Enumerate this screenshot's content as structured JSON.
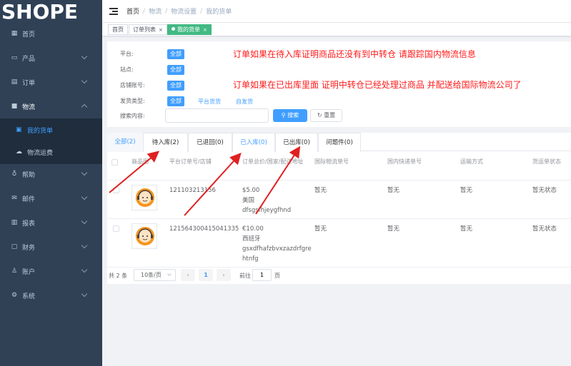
{
  "app": {
    "logo": "SHOPE"
  },
  "sidebar": {
    "items": [
      {
        "label": "首页",
        "icon": "dashboard-icon"
      },
      {
        "label": "产品",
        "icon": "product-icon"
      },
      {
        "label": "订单",
        "icon": "order-icon"
      },
      {
        "label": "物流",
        "icon": "truck-icon"
      },
      {
        "label": "帮助",
        "icon": "help-icon"
      },
      {
        "label": "邮件",
        "icon": "mail-icon"
      },
      {
        "label": "报表",
        "icon": "report-icon"
      },
      {
        "label": "财务",
        "icon": "finance-icon"
      },
      {
        "label": "账户",
        "icon": "user-icon"
      },
      {
        "label": "系统",
        "icon": "settings-icon"
      }
    ],
    "sub": [
      {
        "label": "我的货单",
        "icon": "list-icon"
      },
      {
        "label": "物流运费",
        "icon": "shipping-icon"
      }
    ]
  },
  "breadcrumb": [
    "首页",
    "物流",
    "物流设置",
    "我的货单"
  ],
  "tags": [
    {
      "label": "首页"
    },
    {
      "label": "订单列表",
      "close": "×"
    },
    {
      "label": "我的货单",
      "close": "×"
    }
  ],
  "filter": {
    "platform_label": "平台:",
    "site_label": "站点:",
    "account_label": "店铺账号:",
    "ship_type_label": "发货类型:",
    "search_label": "搜索内容:",
    "all": "全部",
    "platform_ship": "平台货货",
    "self_ship": "自发货",
    "search_placeholder": "",
    "search_btn": "搜索",
    "reset_btn": "重置"
  },
  "annotations": {
    "note1": "订单如果在待入库证明商品还没有到中转仓 请跟踪国内物流信息",
    "note2": "订单如果在已出库里面 证明中转仓已经处理过商品 并配送给国际物流公司了"
  },
  "tabs": [
    "全部(2)",
    "待入库(2)",
    "已退回(0)",
    "已入库(0)",
    "已出库(0)",
    "问题件(0)"
  ],
  "table": {
    "headers": [
      "商品图",
      "平台订单号/店铺",
      "订单总价/国家/配送地址",
      "国际物流单号",
      "国内快递单号",
      "运输方式",
      "货运单状态"
    ],
    "rows": [
      {
        "order_no": "121103213156",
        "price": "$5.00",
        "country": "美国",
        "address": "dfsgsfhjeygfhnd",
        "intl_no": "暂无",
        "domestic_no": "暂无",
        "transport": "暂无",
        "status": "暂无状态"
      },
      {
        "order_no": "121564300415041335",
        "price": "€10.00",
        "country": "西班牙",
        "address": "gsxdfhafzbvxzazdrfgrehtnfg",
        "intl_no": "暂无",
        "domestic_no": "暂无",
        "transport": "暂无",
        "status": "暂无状态"
      }
    ]
  },
  "pagination": {
    "total": "共 2 条",
    "page_size": "10条/页",
    "prev": "‹",
    "next": "›",
    "current": "1",
    "goto_label": "前往",
    "goto_value": "1",
    "page_suffix": "页"
  },
  "colors": {
    "sidebar": "#304156",
    "accent": "#409eff",
    "tag_active": "#42b983",
    "annotation": "#ff1a1a"
  }
}
